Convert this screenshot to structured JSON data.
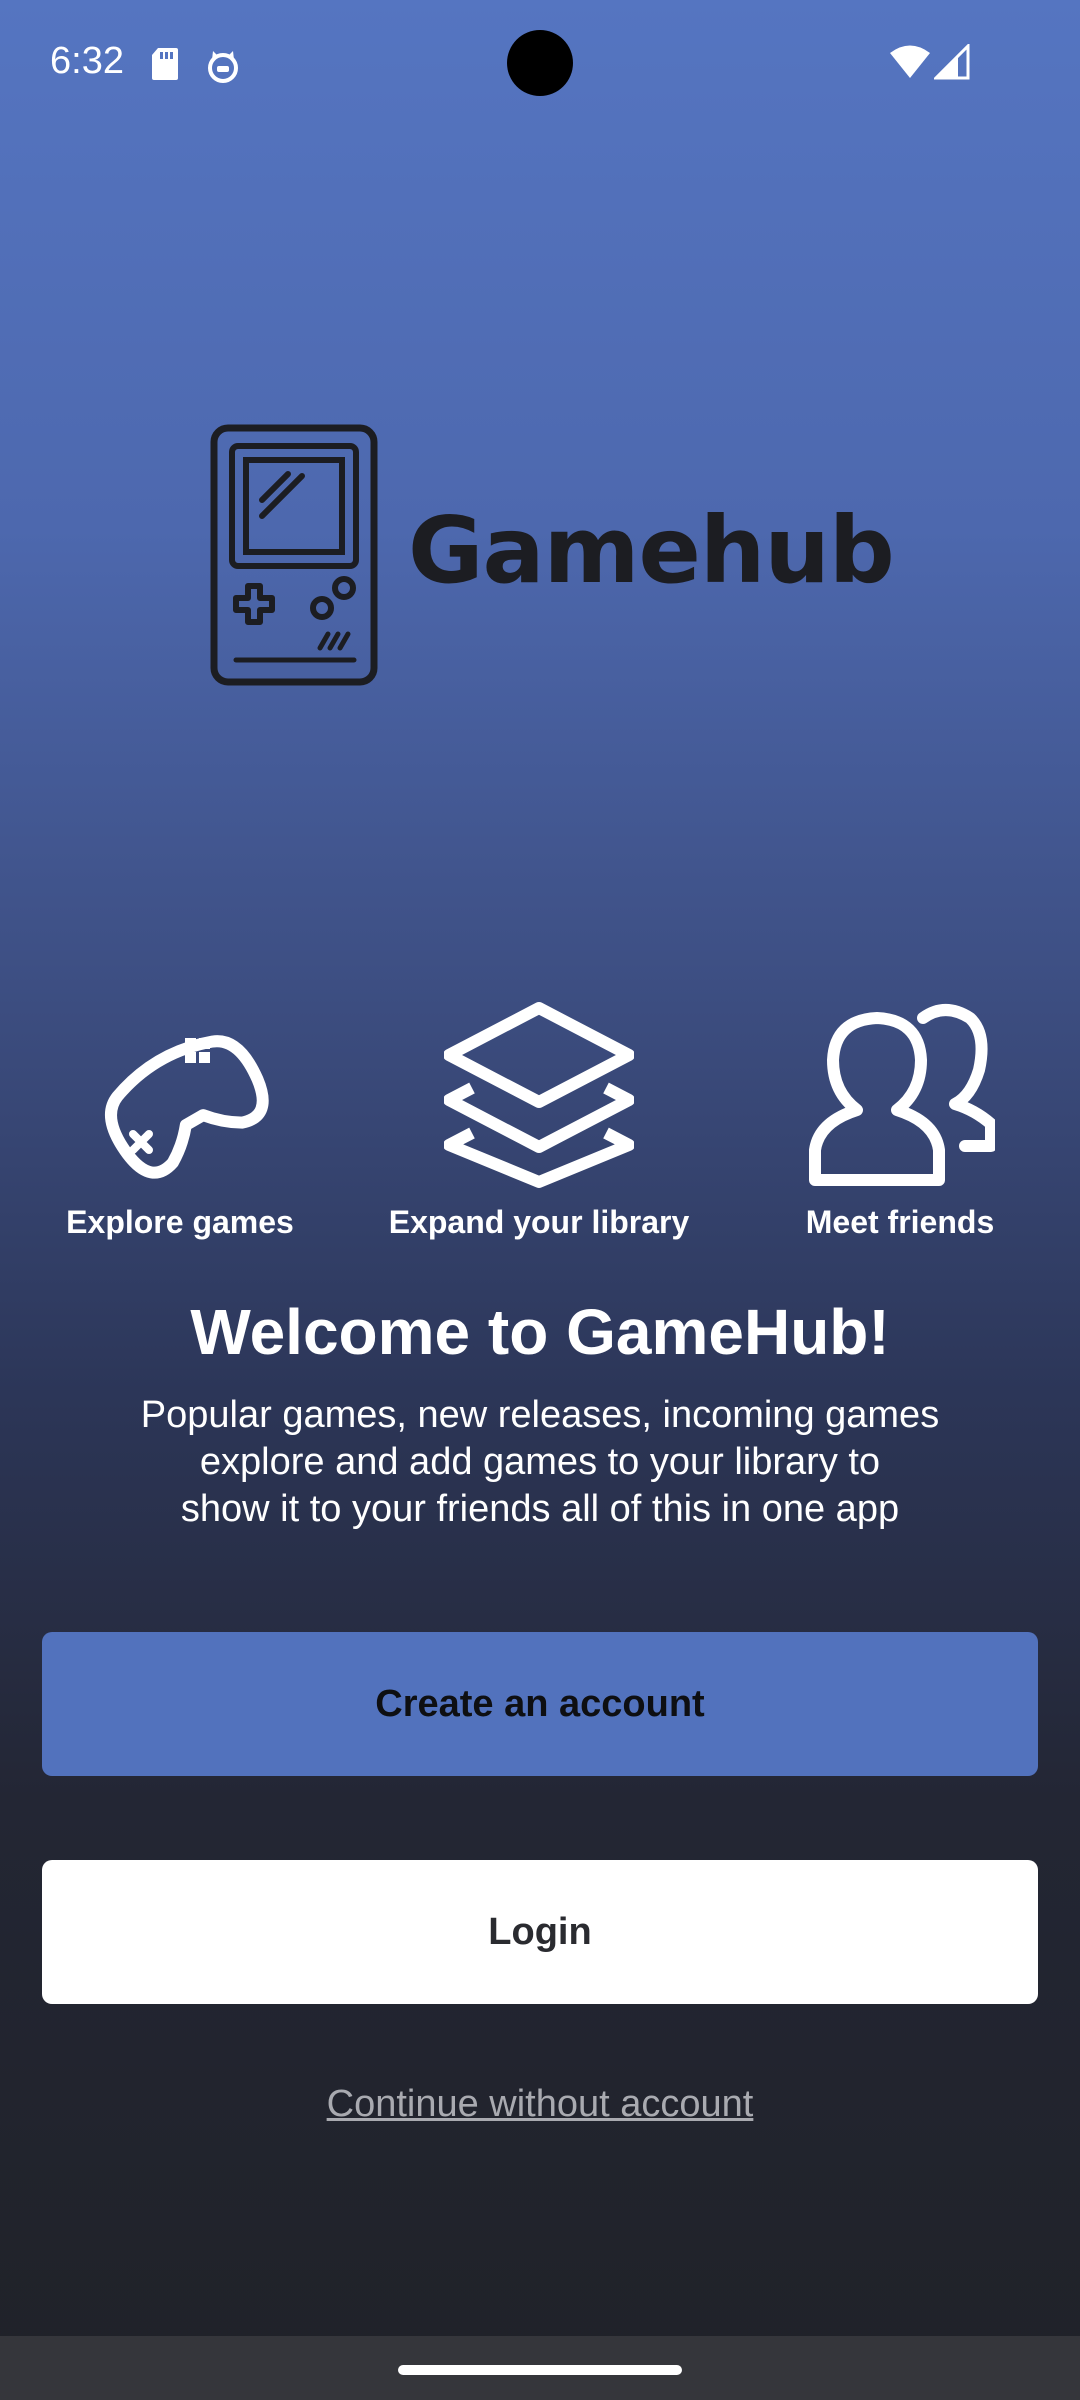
{
  "status_bar": {
    "time": "6:32",
    "icons": [
      "sd-card-icon",
      "cat-icon",
      "wifi-icon",
      "signal-icon"
    ]
  },
  "logo": {
    "brand_name": "Gamehub",
    "icon": "handheld-console-icon"
  },
  "features": [
    {
      "icon": "gamepad-icon",
      "label": "Explore games"
    },
    {
      "icon": "layers-icon",
      "label": "Expand your library"
    },
    {
      "icon": "users-icon",
      "label": "Meet friends"
    }
  ],
  "welcome": {
    "title": "Welcome to GameHub!",
    "description_lines": [
      "Popular games, new releases, incoming games",
      "explore and add games to your library to",
      "show it to your friends all of this in one app"
    ]
  },
  "actions": {
    "create_account": "Create an account",
    "login": "Login",
    "continue_without_account": "Continue without account"
  },
  "colors": {
    "gradient_top": "#5575c1",
    "gradient_bottom": "#202228",
    "primary_button": "#5272bd",
    "secondary_button": "#ffffff",
    "link": "#a9aab0"
  }
}
